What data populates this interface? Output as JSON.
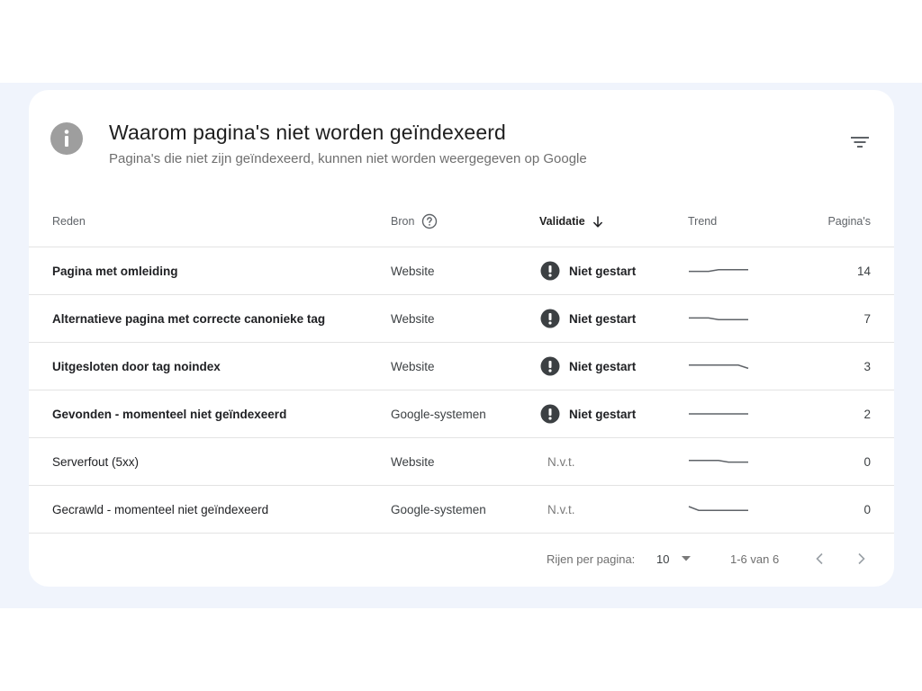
{
  "header": {
    "icon": "info-icon",
    "title": "Waarom pagina's niet worden geïndexeerd",
    "subtitle": "Pagina's die niet zijn geïndexeerd, kunnen niet worden weergegeven op Google",
    "filter_icon": "filter-icon"
  },
  "table": {
    "columns": {
      "reden": "Reden",
      "bron": "Bron",
      "validatie": "Validatie",
      "trend": "Trend",
      "paginas": "Pagina's"
    },
    "rows": [
      {
        "reason": "Pagina met omleiding",
        "source": "Website",
        "validation": "Niet gestart",
        "pages": "14",
        "trend": [
          0.55,
          0.55,
          0.55,
          0.4,
          0.4,
          0.4,
          0.4
        ]
      },
      {
        "reason": "Alternatieve pagina met correcte canonieke tag",
        "source": "Website",
        "validation": "Niet gestart",
        "pages": "7",
        "trend": [
          0.45,
          0.45,
          0.45,
          0.6,
          0.6,
          0.6,
          0.6
        ]
      },
      {
        "reason": "Uitgesloten door tag noindex",
        "source": "Website",
        "validation": "Niet gestart",
        "pages": "3",
        "trend": [
          0.4,
          0.4,
          0.4,
          0.4,
          0.4,
          0.4,
          0.7
        ]
      },
      {
        "reason": "Gevonden - momenteel niet geïndexeerd",
        "source": "Google-systemen",
        "validation": "Niet gestart",
        "pages": "2",
        "trend": [
          0.5,
          0.5,
          0.5,
          0.5,
          0.5,
          0.5,
          0.5
        ]
      },
      {
        "reason": "Serverfout (5xx)",
        "source": "Website",
        "validation": "N.v.t.",
        "pages": "0",
        "trend": [
          0.4,
          0.4,
          0.4,
          0.4,
          0.55,
          0.55,
          0.55
        ]
      },
      {
        "reason": "Gecrawld - momenteel niet geïndexeerd",
        "source": "Google-systemen",
        "validation": "N.v.t.",
        "pages": "0",
        "trend": [
          0.25,
          0.6,
          0.6,
          0.6,
          0.6,
          0.6,
          0.6
        ]
      }
    ]
  },
  "pagination": {
    "rows_per_page_label": "Rijen per pagina:",
    "rows_per_page_value": "10",
    "range": "1-6 van 6"
  },
  "colors": {
    "band": "#f0f4fc",
    "status_icon": "#3c4043",
    "trend_line": "#5f6368"
  }
}
